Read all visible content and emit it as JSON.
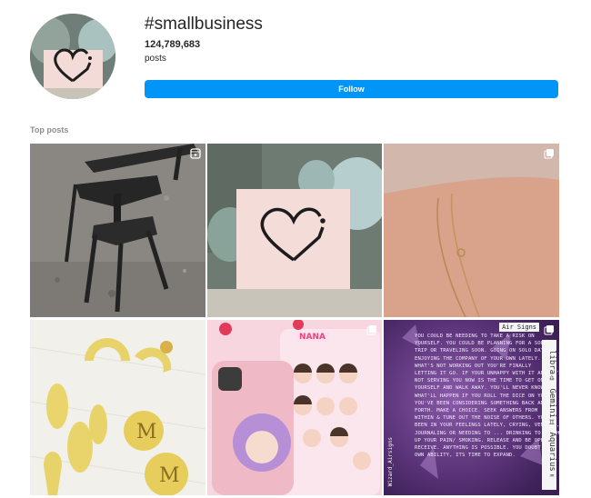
{
  "header": {
    "hashtag": "#smallbusiness",
    "post_count": "124,789,683",
    "post_label": "posts",
    "follow_label": "Follow"
  },
  "sections": {
    "top_posts_label": "Top posts"
  },
  "tiles": [
    {
      "name": "metal-stand-post",
      "icon": "reel-icon"
    },
    {
      "name": "heart-sign-post",
      "icon": ""
    },
    {
      "name": "bracelet-post",
      "icon": "carousel-icon"
    },
    {
      "name": "gold-earrings-post",
      "icon": ""
    },
    {
      "name": "phone-case-stickers-post",
      "icon": "carousel-icon"
    },
    {
      "name": "air-signs-post",
      "icon": "carousel-icon"
    }
  ],
  "air_signs_post": {
    "header": "Air Signs",
    "side_label": "libra♎ Gemini♊ Aquarius♒",
    "left_label": "Wizard_Airsigns",
    "lines": [
      "You could be needing to take a risk on",
      "yourself. You could be planning for a solo",
      "trip or traveling soon. Going on solo dates,",
      "enjoying the company of your own lately.",
      "What's not working out you're finally",
      "letting it go. If your unhappy with it and it's",
      "not serving you now is the time to get on",
      "yourself and walk away. You'll never know",
      "what'll happen if you roll the dice on you.",
      "You've been considering something back and",
      "forth. Make a choice. Seek answers from",
      "within & tune out the noise of others. You've",
      "been in your feelings lately, crying, venting,",
      "journaling or needing to ... drinking to patch",
      "up your pain/ smoking. Release and be open to",
      "receive. Anything is possible. You doubt your",
      "own ability, its time to expand."
    ]
  },
  "sticker_post": {
    "title": "NANA"
  },
  "colors": {
    "follow_button": "#0095f6",
    "muted_text": "#8e8e8e",
    "primary_text": "#262626"
  }
}
